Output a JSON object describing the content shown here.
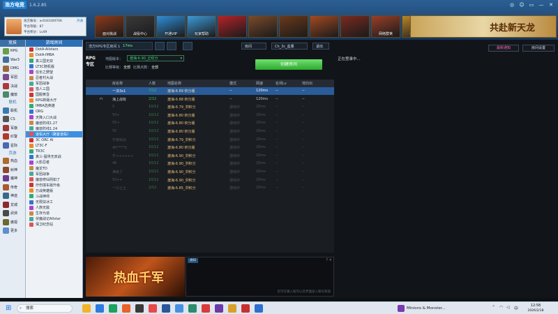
{
  "app": {
    "logo": "浩方电竞",
    "version": "1.6.2.85"
  },
  "window_controls": [
    "◎",
    "☺",
    "▭",
    "—",
    "✕"
  ],
  "user": {
    "line1": "浩方账号：≥4183300706",
    "line2": "平台等级：87",
    "line3": "平台积分：Lv49",
    "vip": "开通"
  },
  "top_tiles": [
    {
      "label": "面对挑战",
      "color": "#8c3a1c"
    },
    {
      "label": "战役中心",
      "color": "#3a3a3a"
    },
    {
      "label": "开通VIP",
      "color": "#2f8ed8"
    },
    {
      "label": "玩家帮助",
      "color": "#3d9ad8"
    },
    {
      "label": "",
      "color": "#b4232a"
    },
    {
      "label": "",
      "color": "#7a4a2a"
    },
    {
      "label": "",
      "color": "#6a3a1a"
    },
    {
      "label": "",
      "color": "#a24a22"
    },
    {
      "label": "",
      "color": "#7a2a20"
    },
    {
      "label": "网络群英",
      "color": "#9a3f28"
    },
    {
      "label": "会员特权",
      "color": "#b8862a"
    }
  ],
  "promo_banner": {
    "text": "共赴新天龙"
  },
  "icon_bar": {
    "header": "竞技",
    "items": [
      {
        "label": "RPG",
        "color": "#6a9e4a"
      },
      {
        "label": "War3",
        "color": "#3f6f9a"
      },
      {
        "label": "DMG",
        "color": "#9a6a3a"
      },
      {
        "label": "军团",
        "color": "#7a4a8a"
      },
      {
        "label": "决战",
        "color": "#aa3a3a"
      },
      {
        "label": "魔兽",
        "color": "#4a8a6a"
      }
    ],
    "section1": "联机",
    "items2": [
      {
        "label": "联机",
        "color": "#3a7ab0"
      },
      {
        "label": "CS",
        "color": "#555"
      },
      {
        "label": "军旗",
        "color": "#9a3a3a"
      },
      {
        "label": "红警",
        "color": "#b03a2a"
      },
      {
        "label": "星际",
        "color": "#4a6ab0"
      }
    ],
    "section2": "页游",
    "items3": [
      {
        "label": "热血",
        "color": "#b06a2a"
      },
      {
        "label": "射神",
        "color": "#8a4a2a"
      },
      {
        "label": "魔神",
        "color": "#6a3a8a"
      },
      {
        "label": "传奇",
        "color": "#aa5a2a"
      },
      {
        "label": "神途",
        "color": "#3a6a8a"
      },
      {
        "label": "龙城",
        "color": "#8a2a2a"
      },
      {
        "label": "武侠",
        "color": "#4a4a4a"
      },
      {
        "label": "傲视",
        "color": "#6a6a2a"
      }
    ],
    "more": "更多"
  },
  "game_list": {
    "header": "游戏房间",
    "items": [
      "DotA-Allstars",
      "DotA-IMBA",
      "真三国无双",
      "LT3C随机版",
      "信长之野望",
      "忍者村大战",
      "军团战争",
      "猎人三国",
      "国服黄昏",
      "RPG新版大厅",
      "IMBA选英雄",
      "ORG",
      "天降入口大战",
      "魔兽防线1.27",
      "魔兽防线1.24",
      "道佑大厅（路客道佑）",
      "3C ORC AI",
      "LT3C-F",
      "TR3C",
      "真三·猛将无双战",
      "火影忍者",
      "魔龙TD",
      "军团战争",
      "魔兽修仙则如了",
      "疗伤撞车版升级",
      "万战英雄版",
      "斗战神师",
      "无限扶冰工",
      "人族无敌",
      "生存为道",
      "伏魔战记Allstar",
      "保卫纪念站"
    ],
    "selected_index": 15
  },
  "room_bar": {
    "location": "浩方RPG专区房间 1",
    "ping": "17ms",
    "tab_active": "房间",
    "tab_channel": "Ch_3c_血量",
    "tab_exit": "退出"
  },
  "map_controls": {
    "rpg_logo_top": "RPG",
    "rpg_logo_bottom": "专区",
    "map_label": "地图版本：",
    "map_value": "渡海-6.90_正经分",
    "filter_label": "比赛等级：",
    "filter_value": "全部",
    "score_label": "比赛点数：",
    "score_value": "全部",
    "create_button": "创建房间"
  },
  "room_table": {
    "headers": [
      "房名称",
      "人数",
      "地图名称",
      "模式",
      "网速",
      "名师Lv",
      "地均出"
    ],
    "rows": [
      {
        "name": "一决3x1",
        "players": "7/12",
        "map": "渡海-6.89 积分版",
        "mode": "--",
        "ping": "120ms",
        "lv": "--",
        "avg": "--",
        "state": "sel"
      },
      {
        "name": "海上战有",
        "players": "2/12",
        "map": "渡海-6.88 积分版",
        "mode": "--",
        "ping": "120ms",
        "lv": "--",
        "avg": "--",
        "state": "active",
        "locked": true
      },
      {
        "name": "S",
        "players": "10/12",
        "map": "渡海-6.79_洪积分",
        "mode": "游戏中",
        "ping": "20ms",
        "lv": "--",
        "avg": "--",
        "state": "dim"
      },
      {
        "name": "50+",
        "players": "10/12",
        "map": "渡海-6.80 积分版",
        "mode": "游戏中",
        "ping": "20ms",
        "lv": "--",
        "avg": "--",
        "state": "dim"
      },
      {
        "name": "55+",
        "players": "10/12",
        "map": "渡海-6.80 积分版",
        "mode": "游戏中",
        "ping": "20ms",
        "lv": "--",
        "avg": "--",
        "state": "dim"
      },
      {
        "name": "55",
        "players": "10/12",
        "map": "渡海-6.80 积分版",
        "mode": "游戏中",
        "ping": "20ms",
        "lv": "--",
        "avg": "--",
        "state": "dim"
      },
      {
        "name": "升级始出",
        "players": "10/12",
        "map": "渡海-6.79_洪积分",
        "mode": "游戏中",
        "ping": "20ms",
        "lv": "--",
        "avg": "--",
        "state": "dim"
      },
      {
        "name": "40****元",
        "players": "10/12",
        "map": "渡海-6.80 积分版",
        "mode": "游戏中",
        "ping": "20ms",
        "lv": "--",
        "avg": "--",
        "state": "dim"
      },
      {
        "name": "升++++++",
        "players": "10/12",
        "map": "渡海-6.90_洪积分",
        "mode": "游戏中",
        "ping": "20ms",
        "lv": "--",
        "avg": "--",
        "state": "dim"
      },
      {
        "name": "46",
        "players": "10/12",
        "map": "渡海-6.90_洪积分",
        "mode": "游戏中",
        "ping": "20ms",
        "lv": "--",
        "avg": "--",
        "state": "dim"
      },
      {
        "name": "满级了",
        "players": "10/12",
        "map": "渡海-6.90_洪积分",
        "mode": "游戏中",
        "ping": "20ms",
        "lv": "--",
        "avg": "--",
        "state": "dim"
      },
      {
        "name": "50++",
        "players": "10/12",
        "map": "渡海-6.90_洪积分",
        "mode": "游戏中",
        "ping": "20ms",
        "lv": "--",
        "avg": "--",
        "state": "dim"
      },
      {
        "name": "一只土土",
        "players": "2/12",
        "map": "渡海-6.85_洪积分",
        "mode": "游戏中",
        "ping": "20ms",
        "lv": "--",
        "avg": "--",
        "state": "dim"
      }
    ]
  },
  "ad_banner": {
    "text": "热血千军"
  },
  "chat": {
    "tab": "通知",
    "help": "?",
    "close": "✕",
    "hint": "您可在输入框内以及界面加入聊天频道"
  },
  "status_text": "正在登录中...",
  "side_buttons": {
    "notice": "最新通知",
    "settings": "房间设置"
  },
  "taskbar": {
    "search": "搜索",
    "media_title": "Minions & Monster...",
    "time": "12:58",
    "date": "2026/2/18",
    "lang": "中",
    "apps": [
      {
        "color": "#f0b429"
      },
      {
        "color": "#2e7be0"
      },
      {
        "color": "#1aa260"
      },
      {
        "color": "#e8632b"
      },
      {
        "color": "#3a3a3a"
      },
      {
        "color": "#e64a4a"
      },
      {
        "color": "#2b579a"
      },
      {
        "color": "#4a90e2"
      },
      {
        "color": "#2c8c6c"
      },
      {
        "color": "#d83b3b"
      },
      {
        "color": "#6a3aa8"
      },
      {
        "color": "#d8a02a"
      },
      {
        "color": "#c83030"
      },
      {
        "color": "#2f6fd0"
      }
    ]
  }
}
